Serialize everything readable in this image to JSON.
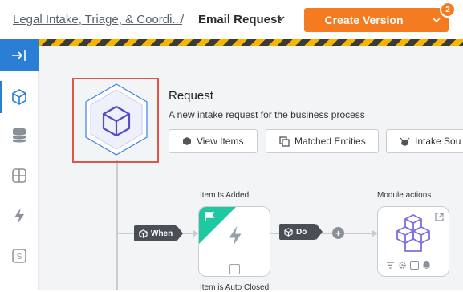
{
  "header": {
    "breadcrumb_parent": "Legal Intake, Triage, & Coordi...",
    "breadcrumb_separator": "/",
    "breadcrumb_current": "Email Request",
    "create_button_label": "Create Version",
    "notification_count": "2"
  },
  "sidebar": {
    "items": [
      {
        "icon": "collapse-panel-icon"
      },
      {
        "icon": "cube-icon",
        "active": true
      },
      {
        "icon": "database-icon"
      },
      {
        "icon": "grid-icon"
      },
      {
        "icon": "lightning-icon"
      },
      {
        "icon": "s-box-icon"
      }
    ]
  },
  "request": {
    "title": "Request",
    "description": "A new intake request for the business process",
    "buttons": [
      {
        "label": "View Items",
        "icon": "cube-icon"
      },
      {
        "label": "Matched Entities",
        "icon": "copy-icon"
      },
      {
        "label": "Intake Sou",
        "icon": "bug-icon"
      }
    ]
  },
  "flow": {
    "when_label": "When",
    "do_label": "Do",
    "plus_label": "+",
    "trigger_node_label": "Item Is Added",
    "action_node_label": "Module actions",
    "trigger_bottom_label": "Item is Auto Closed"
  },
  "colors": {
    "accent_orange": "#f47b20",
    "sidebar_blue": "#2a7fd4",
    "hex_purple": "#5b4bc4",
    "flag_teal": "#1fc8a0",
    "highlight_red": "#e0554a"
  }
}
